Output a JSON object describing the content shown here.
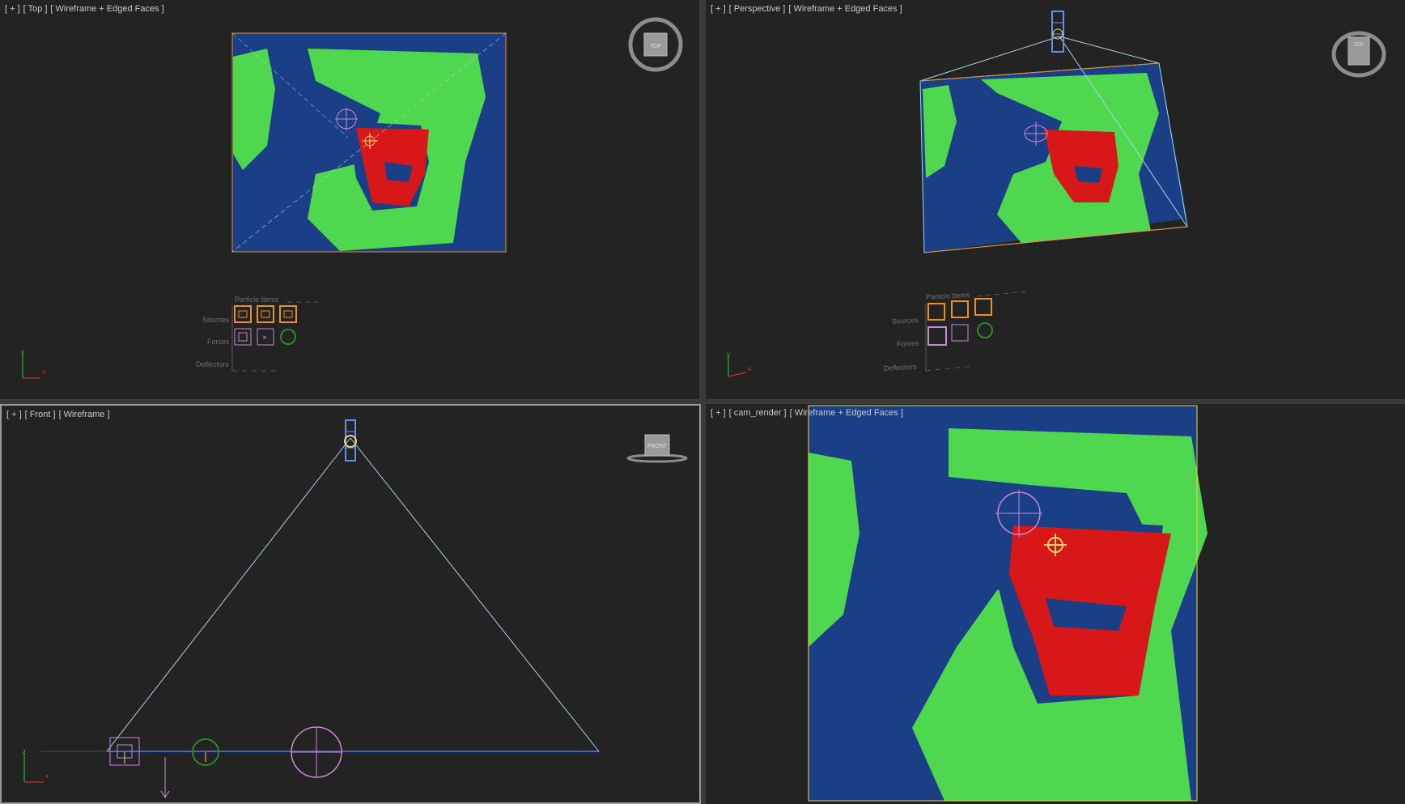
{
  "viewports": {
    "top": {
      "plus": "[ + ]",
      "view": "[ Top ]",
      "shading": "[ Wireframe + Edged Faces ]",
      "cube": "TOP"
    },
    "perspective": {
      "plus": "[ + ]",
      "view": "[ Perspective ]",
      "shading": "[ Wireframe + Edged Faces ]",
      "cube": "TOP"
    },
    "front": {
      "plus": "[ + ]",
      "view": "[ Front ]",
      "shading": "[ Wireframe ]",
      "cube": "FRONT"
    },
    "cam": {
      "plus": "[ + ]",
      "view": "[ cam_render ]",
      "shading": "[ Wireframe + Edged Faces ]"
    }
  },
  "particle_view": {
    "title": "Particle Items",
    "sources": "Sources",
    "forces": "Forces",
    "deflectors": "Deflectors"
  },
  "axes": {
    "x": "x",
    "y": "y",
    "z": "z"
  },
  "colors": {
    "background": "#232323",
    "blue": "#1a4fa0",
    "green": "#5ff05f",
    "red": "#e01c1c",
    "orange": "#e8902a",
    "pink": "#c88ad0",
    "camera_yellow": "#e8d84a",
    "cone_line": "#a8d4e6"
  }
}
